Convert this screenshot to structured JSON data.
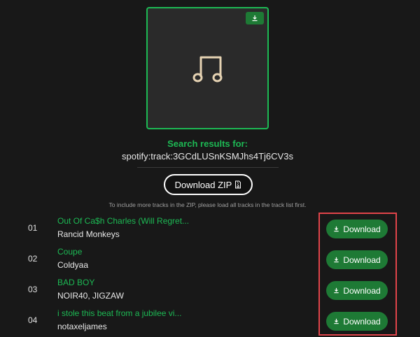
{
  "search": {
    "label": "Search results for:",
    "query": "spotify:track:3GCdLUSnKSMJhs4Tj6CV3s"
  },
  "zip": {
    "label": "Download ZIP",
    "note": "To include more tracks in the ZIP, please load all tracks in the track list first."
  },
  "colors": {
    "accent": "#1db954",
    "button": "#1e7a35",
    "highlight": "#e0444a",
    "background": "#181818"
  },
  "icons": {
    "cover": "music-note-icon",
    "download": "download-icon",
    "zip": "zip-file-icon"
  },
  "tracks": [
    {
      "num": "01",
      "title": "Out Of Ca$h Charles (Will Regret...",
      "artist": "Rancid Monkeys",
      "button": "Download"
    },
    {
      "num": "02",
      "title": "Coupe",
      "artist": "Coldyaa",
      "button": "Download"
    },
    {
      "num": "03",
      "title": "BAD BOY",
      "artist": "NOIR40, JIGZAW",
      "button": "Download"
    },
    {
      "num": "04",
      "title": "i stole this beat from a jubilee vi...",
      "artist": "notaxeljames",
      "button": "Download"
    }
  ]
}
